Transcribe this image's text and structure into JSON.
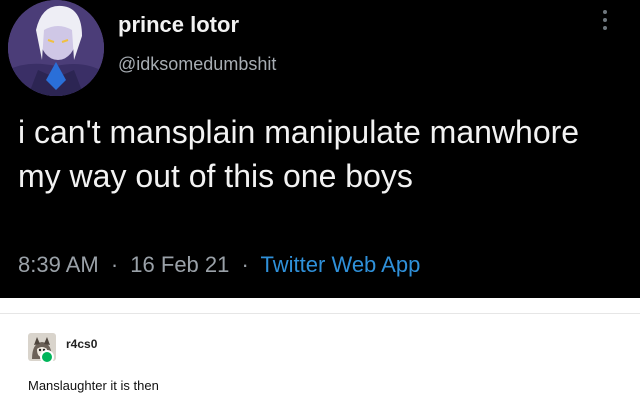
{
  "tweet": {
    "display_name": "prince lotor",
    "handle": "@idksomedumbshit",
    "text": "i can't mansplain manipulate manwhore my way out of this one boys",
    "time": "8:39 AM",
    "date": "16 Feb 21",
    "separator": "·",
    "source": "Twitter Web App",
    "avatar_icon": "anime-character-avatar",
    "more_icon": "vertical-ellipsis-icon",
    "source_color": "#2f90d9"
  },
  "reblog": {
    "username": "r4cs0",
    "comment": "Manslaughter it is then",
    "avatar_icon": "cat-avatar",
    "badge_color": "#00b55a"
  }
}
